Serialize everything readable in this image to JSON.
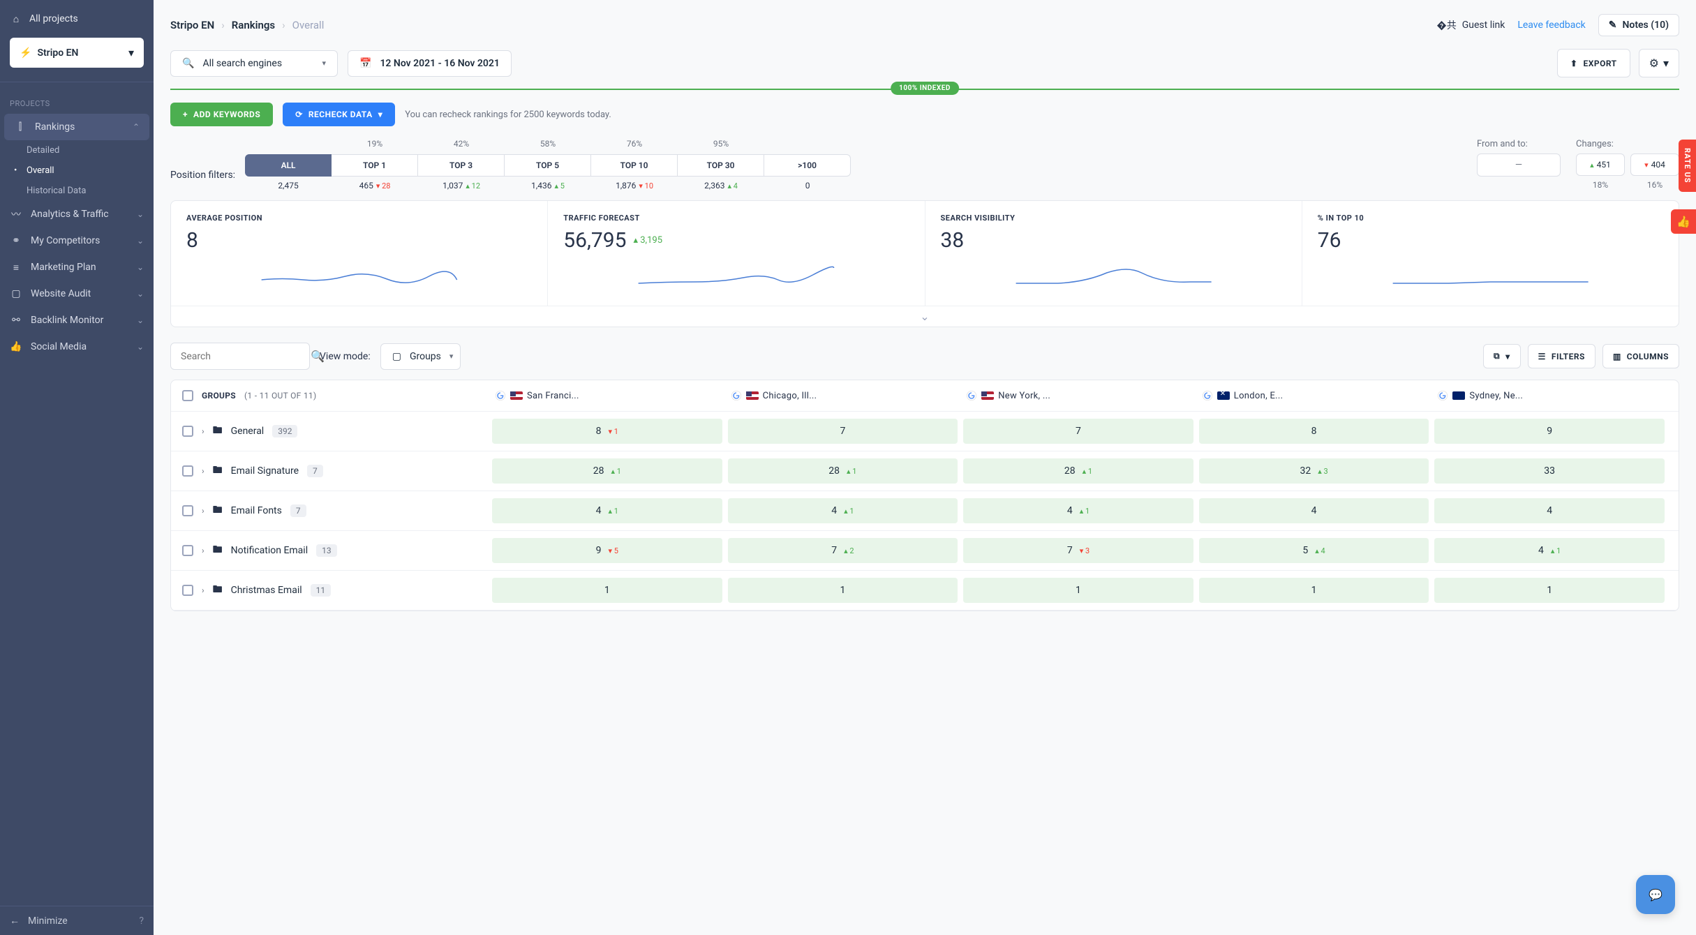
{
  "sidebar": {
    "all_projects": "All projects",
    "project_name": "Stripo EN",
    "section_label": "PROJECTS",
    "nav": [
      {
        "label": "Rankings",
        "icon": "chart-icon",
        "active": true,
        "sub": [
          {
            "label": "Detailed",
            "active": false
          },
          {
            "label": "Overall",
            "active": true
          },
          {
            "label": "Historical Data",
            "active": false
          }
        ]
      },
      {
        "label": "Analytics & Traffic",
        "icon": "pulse-icon"
      },
      {
        "label": "My Competitors",
        "icon": "people-icon"
      },
      {
        "label": "Marketing Plan",
        "icon": "checklist-icon"
      },
      {
        "label": "Website Audit",
        "icon": "monitor-icon"
      },
      {
        "label": "Backlink Monitor",
        "icon": "link-icon"
      },
      {
        "label": "Social Media",
        "icon": "thumb-icon"
      }
    ],
    "minimize": "Minimize"
  },
  "breadcrumb": [
    "Stripo EN",
    "Rankings",
    "Overall"
  ],
  "top_right": {
    "guest": "Guest link",
    "feedback": "Leave feedback",
    "notes": "Notes (10)"
  },
  "controls": {
    "search_engines": "All search engines",
    "date_range": "12 Nov 2021 - 16 Nov 2021",
    "export": "EXPORT"
  },
  "indexed": "100% INDEXED",
  "actions": {
    "add_keywords": "ADD KEYWORDS",
    "recheck": "RECHECK DATA",
    "hint": "You can recheck rankings for 2500 keywords today."
  },
  "position_filters": {
    "label": "Position filters:",
    "cols": [
      {
        "pct": "",
        "label": "ALL",
        "count": "2,475",
        "delta": "",
        "dir": "",
        "active": true
      },
      {
        "pct": "19%",
        "label": "TOP 1",
        "count": "465",
        "delta": "28",
        "dir": "down"
      },
      {
        "pct": "42%",
        "label": "TOP 3",
        "count": "1,037",
        "delta": "12",
        "dir": "up"
      },
      {
        "pct": "58%",
        "label": "TOP 5",
        "count": "1,436",
        "delta": "5",
        "dir": "up"
      },
      {
        "pct": "76%",
        "label": "TOP 10",
        "count": "1,876",
        "delta": "10",
        "dir": "down"
      },
      {
        "pct": "95%",
        "label": "TOP 30",
        "count": "2,363",
        "delta": "4",
        "dir": "up"
      },
      {
        "pct": "",
        "label": ">100",
        "count": "0",
        "delta": "",
        "dir": ""
      }
    ],
    "from_to_label": "From and to:",
    "from_to_placeholder": "—",
    "changes_label": "Changes:",
    "changes_up": "451",
    "changes_down": "404",
    "changes_up_pct": "18%",
    "changes_down_pct": "16%"
  },
  "metrics": [
    {
      "label": "AVERAGE POSITION",
      "value": "8",
      "delta": "",
      "dir": ""
    },
    {
      "label": "TRAFFIC FORECAST",
      "value": "56,795",
      "delta": "3,195",
      "dir": "up"
    },
    {
      "label": "SEARCH VISIBILITY",
      "value": "38",
      "delta": "",
      "dir": ""
    },
    {
      "label": "% IN TOP 10",
      "value": "76",
      "delta": "",
      "dir": ""
    }
  ],
  "chart_data": [
    {
      "type": "line",
      "title": "AVERAGE POSITION",
      "x": [
        1,
        2,
        3,
        4,
        5,
        6,
        7,
        8,
        9,
        10
      ],
      "values": [
        9,
        8.5,
        8,
        8.3,
        8,
        8.4,
        8.1,
        7.9,
        8.2,
        8
      ],
      "ylim": [
        7,
        10
      ]
    },
    {
      "type": "line",
      "title": "TRAFFIC FORECAST",
      "x": [
        1,
        2,
        3,
        4,
        5,
        6,
        7,
        8,
        9,
        10
      ],
      "values": [
        53000,
        53500,
        53800,
        54000,
        54500,
        55200,
        55500,
        55000,
        56200,
        56795
      ],
      "ylim": [
        52000,
        58000
      ]
    },
    {
      "type": "line",
      "title": "SEARCH VISIBILITY",
      "x": [
        1,
        2,
        3,
        4,
        5,
        6,
        7,
        8,
        9,
        10
      ],
      "values": [
        36,
        36,
        36,
        37,
        38,
        42,
        40,
        37,
        37,
        38
      ],
      "ylim": [
        34,
        44
      ]
    },
    {
      "type": "line",
      "title": "% IN TOP 10",
      "x": [
        1,
        2,
        3,
        4,
        5,
        6,
        7,
        8,
        9,
        10
      ],
      "values": [
        74,
        74,
        75,
        75,
        75,
        76,
        76,
        76,
        76,
        76
      ],
      "ylim": [
        72,
        78
      ]
    }
  ],
  "table_controls": {
    "search_placeholder": "Search",
    "view_mode_label": "View mode:",
    "view_mode": "Groups",
    "filters": "FILTERS",
    "columns": "COLUMNS"
  },
  "table": {
    "header_groups": "GROUPS",
    "header_groups_count": "(1 - 11 OUT OF 11)",
    "locations": [
      {
        "name": "San Franci...",
        "flag": "us"
      },
      {
        "name": "Chicago, Ill...",
        "flag": "us"
      },
      {
        "name": "New York, ...",
        "flag": "us"
      },
      {
        "name": "London, E...",
        "flag": "gb"
      },
      {
        "name": "Sydney, Ne...",
        "flag": "au"
      }
    ],
    "rows": [
      {
        "name": "General",
        "count": "392",
        "cells": [
          {
            "v": "8",
            "d": "1",
            "dir": "down"
          },
          {
            "v": "7"
          },
          {
            "v": "7"
          },
          {
            "v": "8"
          },
          {
            "v": "9"
          }
        ]
      },
      {
        "name": "Email Signature",
        "count": "7",
        "cells": [
          {
            "v": "28",
            "d": "1",
            "dir": "up"
          },
          {
            "v": "28",
            "d": "1",
            "dir": "up"
          },
          {
            "v": "28",
            "d": "1",
            "dir": "up"
          },
          {
            "v": "32",
            "d": "3",
            "dir": "up"
          },
          {
            "v": "33"
          }
        ]
      },
      {
        "name": "Email Fonts",
        "count": "7",
        "cells": [
          {
            "v": "4",
            "d": "1",
            "dir": "up"
          },
          {
            "v": "4",
            "d": "1",
            "dir": "up"
          },
          {
            "v": "4",
            "d": "1",
            "dir": "up"
          },
          {
            "v": "4"
          },
          {
            "v": "4"
          }
        ]
      },
      {
        "name": "Notification Email",
        "count": "13",
        "cells": [
          {
            "v": "9",
            "d": "5",
            "dir": "down"
          },
          {
            "v": "7",
            "d": "2",
            "dir": "up"
          },
          {
            "v": "7",
            "d": "3",
            "dir": "down"
          },
          {
            "v": "5",
            "d": "4",
            "dir": "up"
          },
          {
            "v": "4",
            "d": "1",
            "dir": "up"
          }
        ]
      },
      {
        "name": "Christmas Email",
        "count": "11",
        "cells": [
          {
            "v": "1"
          },
          {
            "v": "1"
          },
          {
            "v": "1"
          },
          {
            "v": "1"
          },
          {
            "v": "1"
          }
        ]
      }
    ]
  },
  "rate_us": "RATE US"
}
